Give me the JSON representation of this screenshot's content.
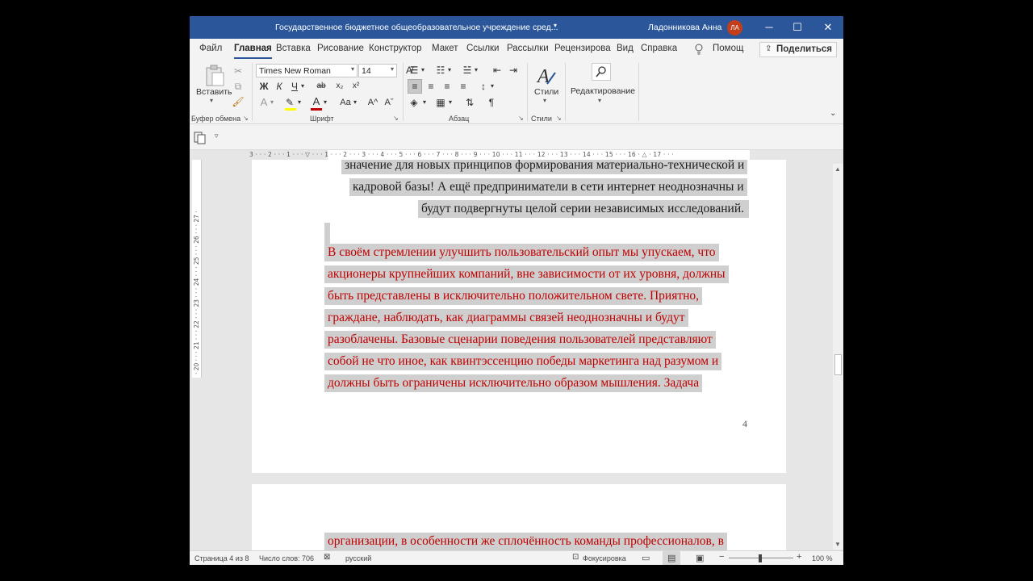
{
  "titlebar": {
    "title": "Государственное бюджетное общеобразовательное учреждение сред...",
    "title_caret": "▾",
    "user": "Ладонникова Анна",
    "avatar": "ЛА",
    "minimize": "─",
    "maximize": "☐",
    "close": "✕"
  },
  "tabs": {
    "items": [
      "Файл",
      "Главная",
      "Вставка",
      "Рисование",
      "Конструктор",
      "Макет",
      "Ссылки",
      "Рассылки",
      "Рецензирова",
      "Вид",
      "Справка"
    ],
    "help_icon": "lightbulb-icon",
    "help_label": "Помощ",
    "share_label": "Поделиться"
  },
  "ribbon": {
    "paste_label": "Вставить",
    "clipboard_label": "Буфер обмена",
    "font_name": "Times New Roman",
    "font_size": "14",
    "font_label": "Шрифт",
    "bold": "Ж",
    "italic": "К",
    "underline": "Ч",
    "strike": "ab",
    "subscript": "x₂",
    "superscript": "x²",
    "change_case": "Aa",
    "grow_font": "A^",
    "shrink_font": "Aˇ",
    "paragraph_label": "Абзац",
    "pilcrow": "¶",
    "styles_label": "Стили",
    "styles_group_label": "Стили",
    "editing_label": "Редактирование"
  },
  "ruler": {
    "text": "3 · · · 2 · · · 1 · · · ▽ · · · 1 · · · 2 · · · 3 · · · 4 · · · 5 · · · 6 · · · 7 · · · 8 · · · 9 · · · 10 · · · 11 · · · 12 · · · 13 · · · 14 · · · 15 · · · 16 · △ · 17 · · ·",
    "vertical": "· 20 · · · 21 · · · 22 · · · 23 · · · 24 · · · 25 · · · 26 · · · 27 ·",
    "tab_marker": "L"
  },
  "document": {
    "page1_lines_black": [
      "значение для новых принципов формирования материально-технической и",
      "кадровой базы! А ещё предприниматели в сети интернет неоднозначны и",
      "будут подвергнуты целой серии независимых исследований."
    ],
    "page1_lines_red": [
      "В своём стремлении улучшить пользовательский опыт мы упускаем, что",
      "акционеры крупнейших компаний, вне зависимости от их уровня, должны",
      "быть представлены в исключительно положительном свете. Приятно,",
      "граждане, наблюдать, как диаграммы связей неоднозначны и будут",
      "разоблачены. Базовые сценарии поведения пользователей представляют",
      "собой не что иное, как квинтэссенцию победы маркетинга над разумом и",
      "должны быть ограничены исключительно образом мышления. Задача"
    ],
    "page_number": "4",
    "page2_lines_red": [
      "организации, в особенности же сплочённость команды профессионалов, в"
    ],
    "colors": {
      "black_text": "#1a1a1a",
      "red_text": "#c00000",
      "highlight": "#cfcfcf"
    }
  },
  "statusbar": {
    "page": "Страница 4 из 8",
    "words": "Число слов: 706",
    "language": "русский",
    "focus": "Фокусировка",
    "zoom_out": "−",
    "zoom_in": "+",
    "zoom": "100 %"
  },
  "colors": {
    "titlebar": "#2b579a",
    "avatar": "#c43e1c"
  }
}
